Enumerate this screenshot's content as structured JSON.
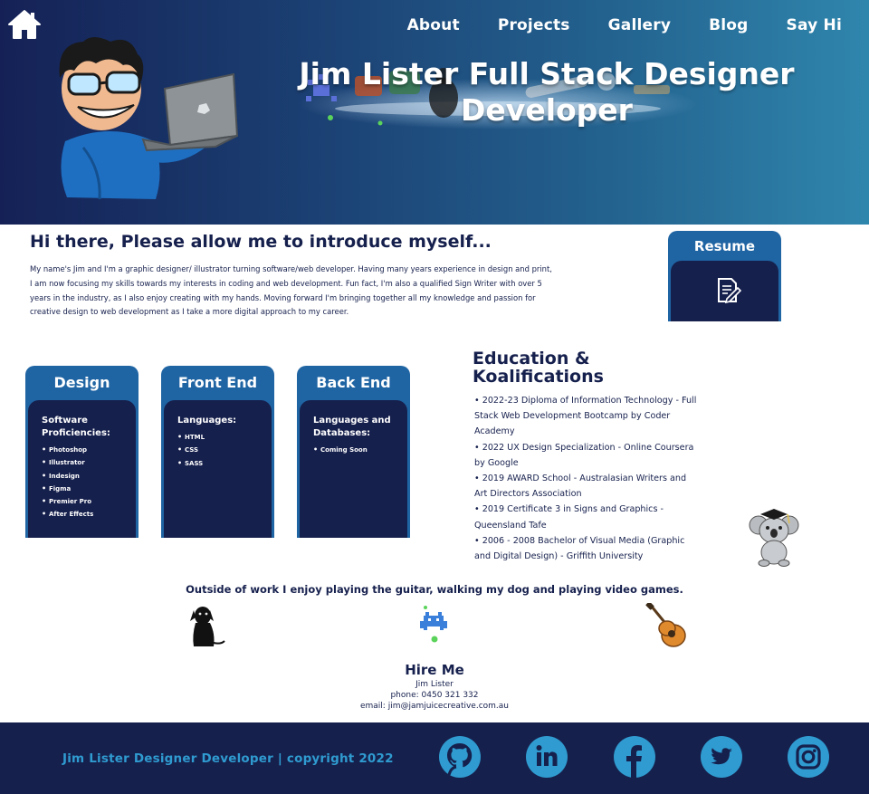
{
  "nav": {
    "items": [
      "About",
      "Projects",
      "Gallery",
      "Blog",
      "Say Hi"
    ]
  },
  "hero": {
    "title": "Jim Lister Full Stack Designer Developer"
  },
  "intro": {
    "heading": "Hi there, Please allow me to introduce myself...",
    "text": "My name's Jim and I'm a graphic designer/ illustrator turning software/web developer. Having many years experience in design and print, I am now focusing my skills towards my interests in coding and web development. Fun fact, I'm also a qualified Sign Writer with over 5 years in the industry, as I also enjoy creating with my hands. Moving forward I'm bringing together all my knowledge and passion for creative design to web development as I take a more digital approach to my career."
  },
  "resume": {
    "title": "Resume"
  },
  "skills": [
    {
      "title": "Design",
      "subtitle": "Software Proficiencies:",
      "items": [
        "Photoshop",
        "Illustrator",
        "Indesign",
        "Figma",
        "Premier Pro",
        "After Effects"
      ]
    },
    {
      "title": "Front End",
      "subtitle": "Languages:",
      "items": [
        "HTML",
        "CSS",
        "SASS"
      ]
    },
    {
      "title": "Back End",
      "subtitle": "Languages and Databases:",
      "items": [
        "Coming Soon"
      ]
    }
  ],
  "education": {
    "heading": "Education & Koalifications",
    "items": [
      "2022-23 Diploma of Information Technology - Full Stack Web Development Bootcamp by Coder Academy",
      "2022 UX Design Specialization - Online Coursera by Google",
      "2019 AWARD School - Australasian Writers and Art Directors Association",
      "2019 Certificate 3 in Signs and Graphics - Queensland Tafe",
      "2006 - 2008 Bachelor of Visual Media (Graphic and Digital Design) - Griffith University"
    ]
  },
  "hobbies": {
    "text": "Outside of work I enjoy playing the guitar, walking my dog and playing video games."
  },
  "hire": {
    "title": "Hire Me",
    "name": "Jim Lister",
    "phone": "phone: 0450 321 332",
    "email": "email: jim@jamjuicecreative.com.au"
  },
  "footer": {
    "copyright": "Jim Lister Designer Developer | copyright 2022",
    "social_icons": [
      "github-icon",
      "linkedin-icon",
      "facebook-icon",
      "twitter-icon",
      "instagram-icon"
    ]
  },
  "colors": {
    "navy": "#16204d",
    "card_blue": "#1f64a3",
    "footer_accent": "#2f9bd0"
  }
}
